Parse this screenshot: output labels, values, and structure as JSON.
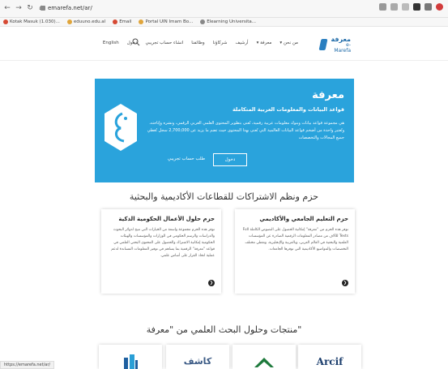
{
  "browser": {
    "url": "emarefa.net/ar/",
    "bookmarks": [
      {
        "label": "Kotak Masuk (1.030)...",
        "color": "#d64933"
      },
      {
        "label": "eduuno.edu.al",
        "color": "#e0a53b"
      },
      {
        "label": "Email",
        "color": "#d64933"
      },
      {
        "label": "Portal UIN Imam Bo...",
        "color": "#e0a53b"
      },
      {
        "label": "Elearning Universita...",
        "color": "#888888"
      }
    ],
    "status_url": "https://emarefa.net/ar/"
  },
  "header": {
    "logo_ar": "معرفة",
    "logo_en": "e-Marefa",
    "nav": [
      "من نحن ▾",
      "معرفة ▾",
      "أرشيف",
      "شركاؤنا",
      "وظائفنا",
      "انشاء حساب تجريبي",
      "دخول",
      "English"
    ]
  },
  "hero": {
    "title": "معرفة",
    "subtitle": "قواعد البيانات والمعلومات العربية المتكاملة",
    "description": "هي مجموعة قواعد بيانات وبنوك معلومات عربية رقمية، تُعنى بتطوير المحتوى العلمي العربي الرقمي، ونشره وإتاحته، وتُعتبر واحدة من أضخم قواعد البيانات العالمية التي تُعنى بهذا المحتوى حيث تضم ما يزيد عن 2,700,000 سجل تُغطي جميع المجالات والتخصصات",
    "login_label": "دخول",
    "create_label": "طلب حساب تجريبي"
  },
  "packages": {
    "heading": "حزم ونظم الاشتراكات للقطاعات الأكاديمية والبحثية",
    "cards": [
      {
        "title": "حزم التعليم الجامعي والأكاديمي",
        "body": "توفر هذه الحزم من \"معرفة\" إمكانية الحصول على النصوص الكاملة Full Texts للآلاف من مصادر المعلومات الرقمية الصادرة عن المؤسسات العلمية والبحثية في العالم العربي، وبالعربية والإنجليزية، وتغطي مختلف التخصصات والمواضيع الأكاديمية التي توفرها الجامعات."
      },
      {
        "title": "حزم حلول الأعمال الحكومية الذكية",
        "body": "توفر هذه الحزم مجموعة واسعة من الخيارات التي تتيح لدوائر البحوث والدراسات والرسم الحكومي في الوزارات والمؤسسات والهيئات الحكومية إمكانية الاشتراك والحصول على المحتوى البحثي العلمي في قواعد \"معرفة\" الرقمية بما يساهم في توفير المعلومات المساندة لدعم عملية اتخاذ القرار على أساس علمي."
      }
    ]
  },
  "products": {
    "heading": "منتجات وحلول البحث العلمي من \"معرفة\"",
    "items": [
      {
        "label": "Arcif"
      },
      {
        "label": ""
      },
      {
        "label": "كاشف"
      },
      {
        "label": ""
      }
    ]
  }
}
